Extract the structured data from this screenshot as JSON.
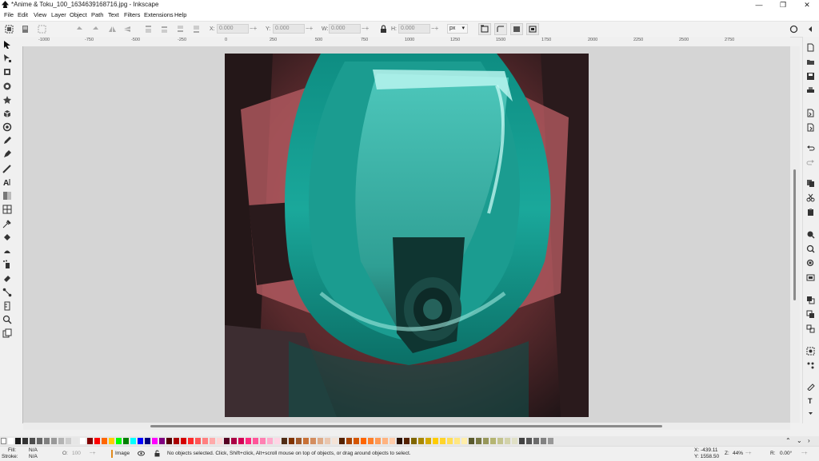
{
  "window": {
    "title": "*Anime & Toku_100_1634639168716.jpg - Inkscape",
    "minimize": "—",
    "maximize": "❐",
    "close": "✕"
  },
  "menu": [
    "File",
    "Edit",
    "View",
    "Layer",
    "Object",
    "Path",
    "Text",
    "Filters",
    "Extensions",
    "Help"
  ],
  "toolbar": {
    "x_label": "X:",
    "x_value": "0.000",
    "y_label": "Y:",
    "y_value": "0.000",
    "w_label": "W:",
    "w_value": "0.000",
    "h_label": "H:",
    "h_value": "0.000",
    "unit": "px"
  },
  "ruler": [
    "-1000",
    "-750",
    "-500",
    "-250",
    "0",
    "250",
    "500",
    "750",
    "1000",
    "1250",
    "1500",
    "1750",
    "2000",
    "2250",
    "2500",
    "2750"
  ],
  "palette": [
    "#ffffff",
    "#1a1a1a",
    "#333333",
    "#4d4d4d",
    "#666666",
    "#808080",
    "#999999",
    "#b3b3b3",
    "#cccccc",
    "#e6e6e6",
    "#ffffff",
    "#800000",
    "#ff0000",
    "#ff6600",
    "#ffcc00",
    "#00ff00",
    "#008000",
    "#00ffff",
    "#0000ff",
    "#000080",
    "#ff00ff",
    "#800080",
    "#550000",
    "#aa0000",
    "#d40000",
    "#ff2a2a",
    "#ff5555",
    "#ff8080",
    "#ffaaaa",
    "#ffd5d5",
    "#550022",
    "#aa0044",
    "#d40055",
    "#ff2a7f",
    "#ff5599",
    "#ff80b2",
    "#ffaacc",
    "#ffd5e5",
    "#502d16",
    "#803300",
    "#a05a2c",
    "#c87137",
    "#d38d5f",
    "#deaa87",
    "#e9c6af",
    "#f4e3d7",
    "#552200",
    "#aa4400",
    "#d45500",
    "#ff6600",
    "#ff7f2a",
    "#ff9955",
    "#ffb380",
    "#ffccaa",
    "#2b1100",
    "#552200",
    "#806600",
    "#aa8800",
    "#d4aa00",
    "#ffcc00",
    "#ffd42a",
    "#ffdd55",
    "#ffe680",
    "#ffeeaa",
    "#5a5a2d",
    "#787844",
    "#97975b",
    "#b5b572",
    "#c3c38e",
    "#d2d2aa",
    "#e0e0c6",
    "#424242",
    "#555555",
    "#6b6b6b",
    "#828282",
    "#989898"
  ],
  "status": {
    "fill_label": "Fill:",
    "fill_value": "N/A",
    "stroke_label": "Stroke:",
    "stroke_value": "N/A",
    "opacity_label": "O:",
    "opacity_value": "100",
    "layer": "Image",
    "message": "No objects selected. Click, Shift+click, Alt+scroll mouse on top of objects, or drag around objects to select.",
    "x_coord": "X: -439.11",
    "y_coord": "Y: 1558.50",
    "zoom_label": "Z:",
    "zoom": "44%",
    "rotate_label": "R:",
    "rotate": "0.00°"
  }
}
